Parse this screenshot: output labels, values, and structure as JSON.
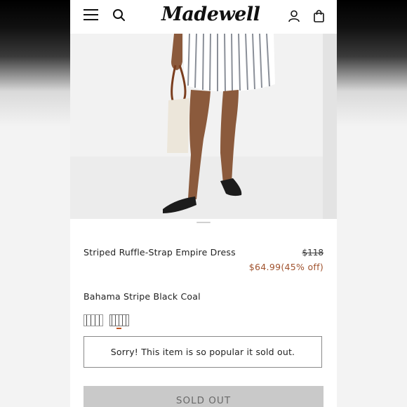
{
  "header": {
    "logo": "Madewell",
    "icons": [
      "menu-icon",
      "search-icon",
      "account-icon",
      "bag-icon"
    ]
  },
  "product": {
    "title": "Striped Ruffle-Strap Empire Dress",
    "original_price": "$118",
    "sale_price": "$64.99(45% off)",
    "color_name": "Bahama Stripe Black Coal",
    "swatches": [
      "Bahama Stripe Black Coal",
      "selected"
    ],
    "soldout_message": "Sorry! This item is so popular it sold out.",
    "soldout_button_label": "SOLD OUT"
  },
  "colors": {
    "sale": "#a0522d",
    "swatch_selected_underline": "#c0521f",
    "soldout_button_bg": "#c9c9c9",
    "scroll_top_bg": "#0b0b0b"
  }
}
